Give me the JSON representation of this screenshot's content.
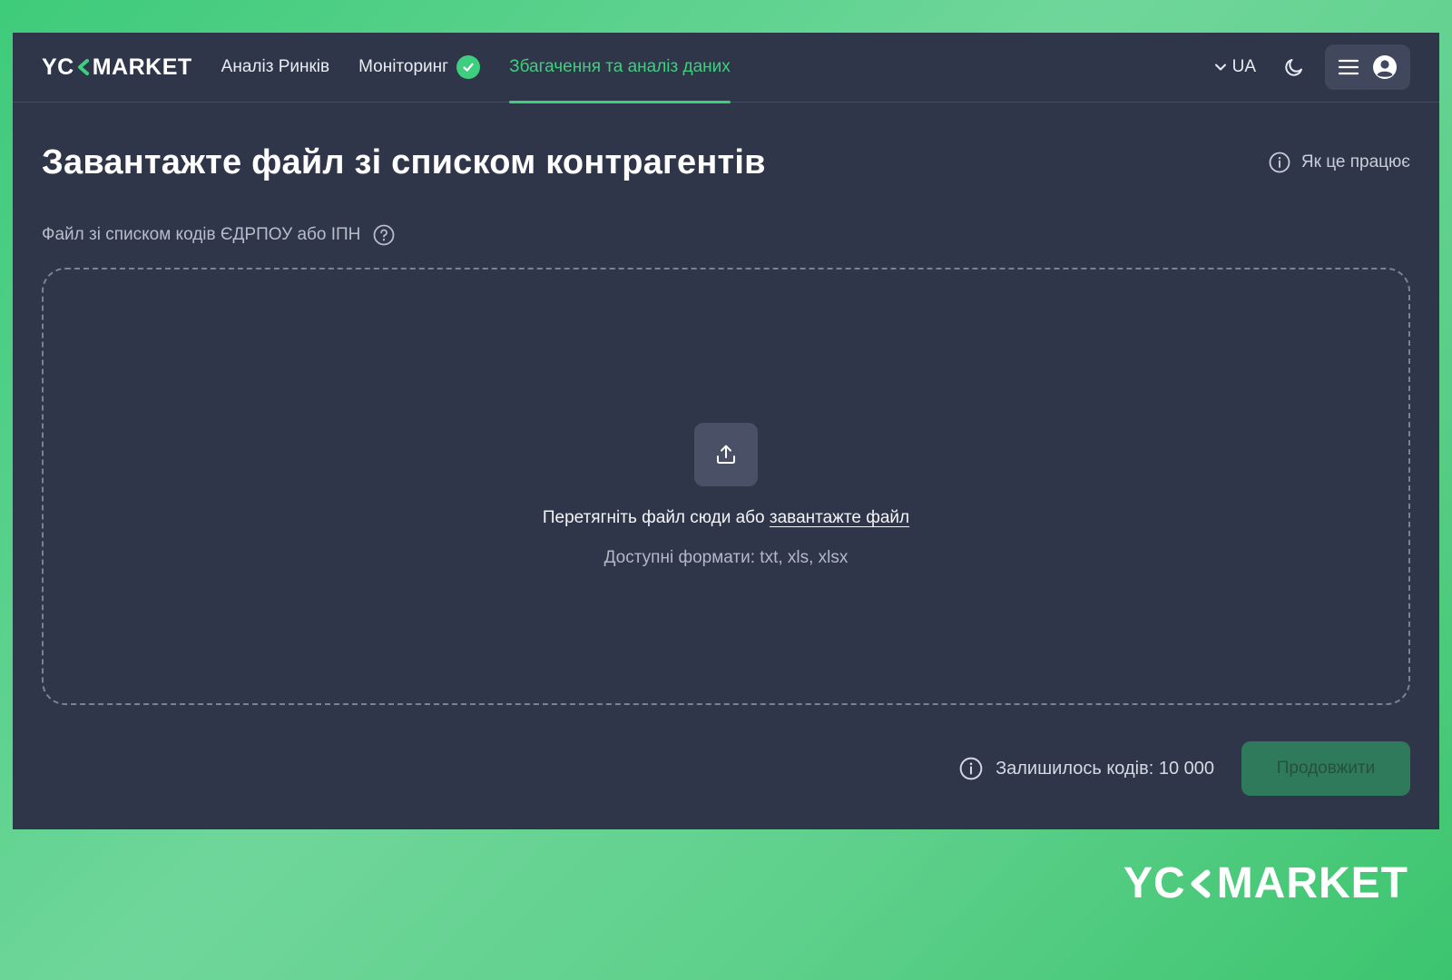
{
  "header": {
    "logo_left": "YC",
    "logo_right": "MARKET",
    "nav": [
      {
        "label": "Аналіз Ринків"
      },
      {
        "label": "Моніторинг"
      },
      {
        "label": "Збагачення та аналіз даних"
      }
    ],
    "lang": "UA"
  },
  "main": {
    "title": "Завантажте файл зі списком контрагентів",
    "how_it_works": "Як це працює",
    "field_label": "Файл зі списком кодів ЄДРПОУ або ІПН",
    "dropzone": {
      "text": "Перетягніть файл сюди або",
      "link": "завантажте файл",
      "formats": "Доступні формати: txt, xls, xlsx"
    },
    "remaining": "Залишилось кодів: 10 000",
    "continue_label": "Продовжити"
  },
  "watermark": {
    "left": "YC",
    "right": "MARKET"
  },
  "colors": {
    "accent": "#3ecf7e",
    "panel": "#30364a",
    "button_disabled": "#2f7a5a"
  },
  "icons": [
    "check-icon",
    "chevron-down-icon",
    "moon-icon",
    "menu-icon",
    "user-icon",
    "info-icon",
    "help-icon",
    "upload-icon"
  ]
}
